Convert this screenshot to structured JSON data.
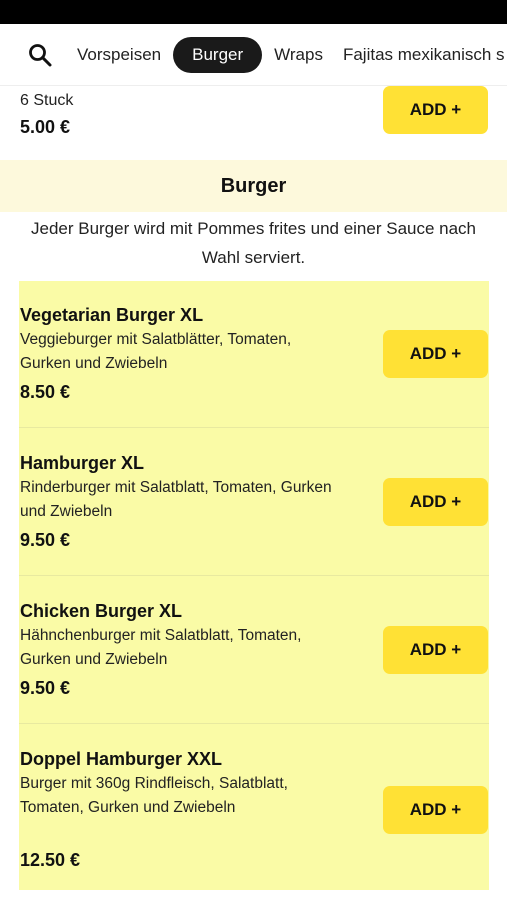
{
  "nav": {
    "search_icon": "search-icon",
    "tabs": [
      {
        "label": "Vorspeisen",
        "active": false
      },
      {
        "label": "Burger",
        "active": true
      },
      {
        "label": "Wraps",
        "active": false
      },
      {
        "label": "Fajitas mexikanisch s",
        "active": false
      }
    ]
  },
  "previous_item": {
    "description": "6 Stuck",
    "price": "5.00 €",
    "add_label": "ADD +"
  },
  "section": {
    "title": "Burger",
    "description": "Jeder Burger wird mit Pommes frites und einer Sauce nach Wahl serviert."
  },
  "items": [
    {
      "name": "Vegetarian Burger XL",
      "description": "Veggieburger mit Salatblätter, Tomaten, Gurken und Zwiebeln",
      "price": "8.50 €",
      "add_label": "ADD +"
    },
    {
      "name": "Hamburger XL",
      "description": "Rinderburger mit Salatblatt, Tomaten, Gurken und Zwiebeln",
      "price": "9.50 €",
      "add_label": "ADD +"
    },
    {
      "name": "Chicken Burger XL",
      "description": "Hähnchenburger mit Salatblatt, Tomaten, Gurken und Zwiebeln",
      "price": "9.50 €",
      "add_label": "ADD +"
    },
    {
      "name": "Doppel Hamburger XXL",
      "description": "Burger mit 360g Rindfleisch, Salatblatt, Tomaten, Gurken und Zwiebeln",
      "price": "12.50 €",
      "add_label": "ADD +"
    }
  ],
  "colors": {
    "accent_button": "#ffe135",
    "item_highlight": "#fafba6",
    "section_header_bg": "#fdf9dc",
    "active_tab": "#1a1a1a"
  }
}
